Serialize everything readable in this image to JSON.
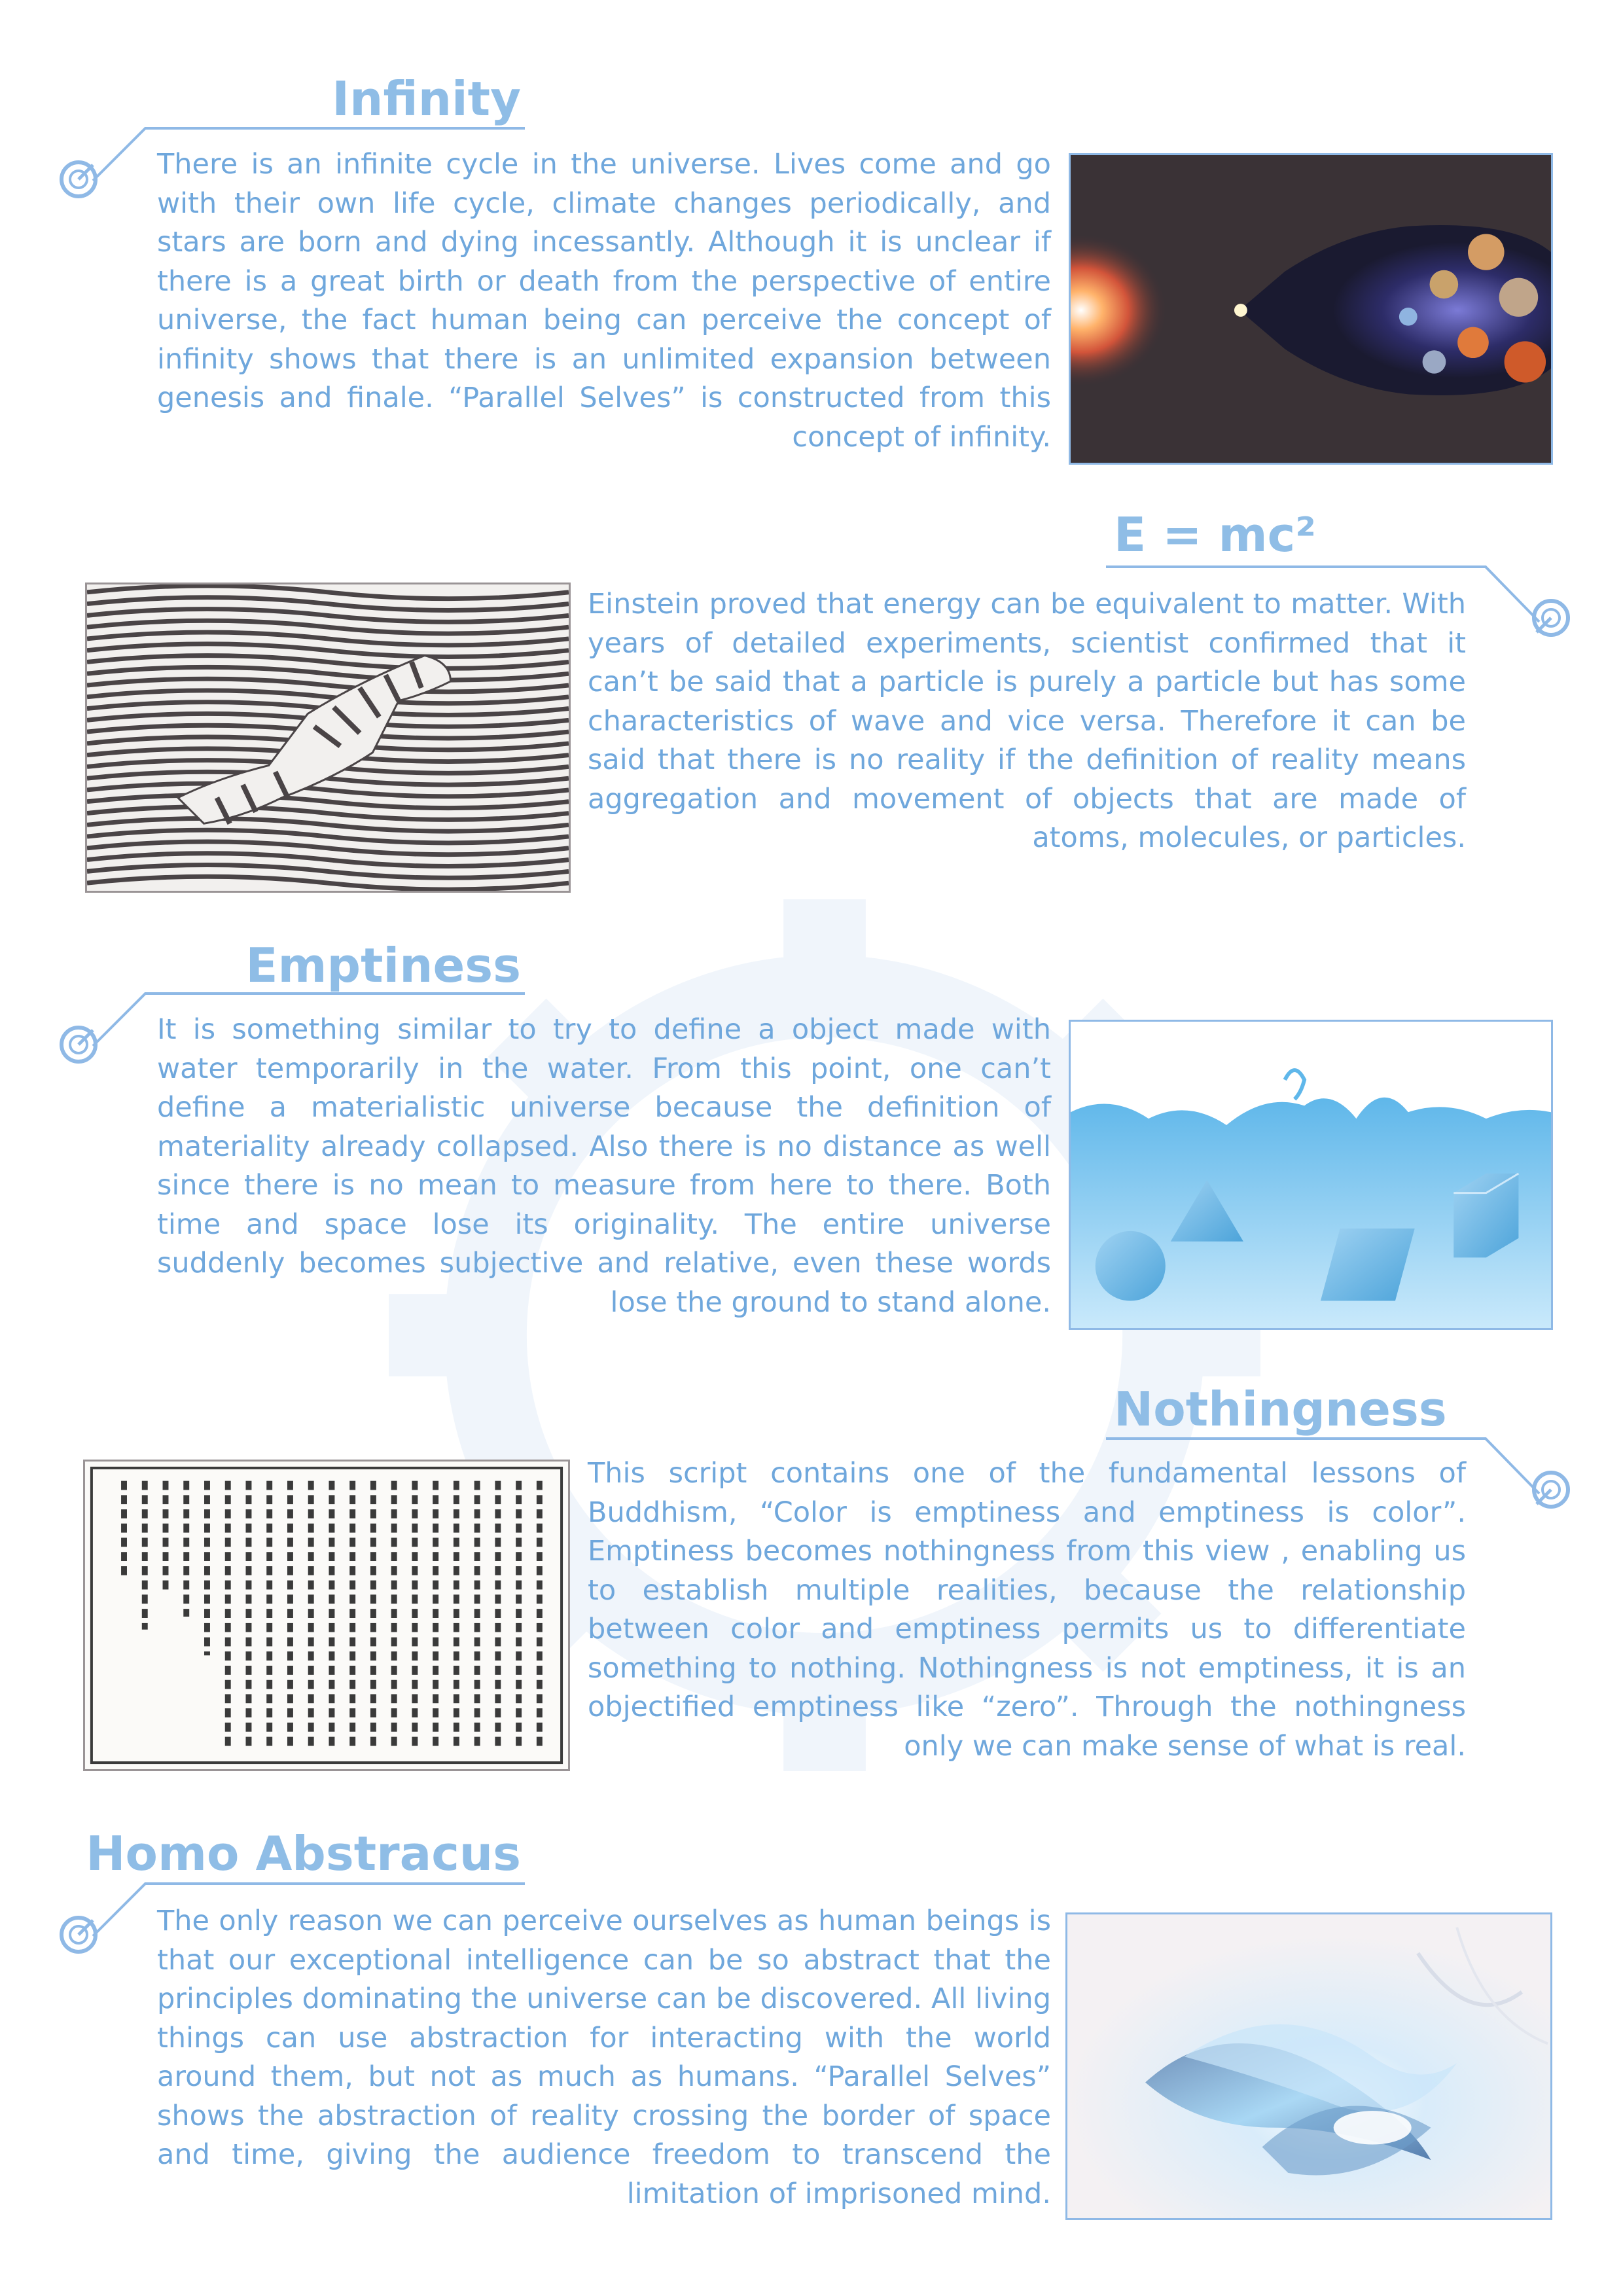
{
  "sections": [
    {
      "title": "Infinity",
      "text": "There is an infinite cycle in the universe. Lives come and go with their own life cycle, climate changes periodically, and stars are born and dying incessantly. Although it is unclear if there is a great birth or death from the perspective of entire universe, the fact human being can perceive the concept of infinity shows that there is an unlimited expansion between genesis and finale. “Parallel Selves” is constructed from this concept of infinity."
    },
    {
      "title": "E = mc²",
      "text": "Einstein proved that energy can be equivalent to matter. With years of detailed experiments, scientist confirmed that it can’t be said that a particle is purely a particle but has some characteristics of wave and vice versa. Therefore it can be said that there is no reality if the definition of reality means aggregation and movement of objects that are made of atoms, molecules, or particles."
    },
    {
      "title": "Emptiness",
      "text": "It is something similar to try to define a object made with water temporarily in the water. From this point, one can’t define a materialistic universe because the definition of materiality already collapsed. Also there is no distance as well since there is no mean to measure from here to there. Both time and space lose its originality. The entire universe suddenly becomes subjective and relative, even these words lose the ground to stand alone."
    },
    {
      "title": "Nothingness",
      "text": "This script contains one of the fundamental lessons of Buddhism, “Color is emptiness and emptiness is color”. Emptiness becomes nothingness from this view , enabling us to establish multiple realities, because the relationship between color and emptiness permits us to differentiate something to nothing. Nothingness is not emptiness, it is an objectified emptiness like “zero”. Through the nothingness only we can make sense of what is real."
    },
    {
      "title": "Homo Abstracus",
      "text": "The only reason we can perceive ourselves as human beings is that our exceptional intelligence can be so abstract that the principles dominating the universe can be discovered. All living things can use abstraction for interacting with the world around them, but not as much as humans. “Parallel Selves” shows the abstraction of reality crossing the border of space and time, giving the audience freedom to transcend the limitation of imprisoned mind."
    }
  ],
  "images": [
    {
      "icon": "cosmic-bottle-illustration"
    },
    {
      "icon": "zebra-wave-op-art"
    },
    {
      "icon": "water-shapes-illustration"
    },
    {
      "icon": "buddhist-sutra-scan"
    },
    {
      "icon": "abstract-light-swirl"
    }
  ],
  "colors": {
    "title": "#8fbde6",
    "text": "#6fa7dc",
    "line": "#8fb9e6",
    "watermark": "#3c7fd0"
  }
}
